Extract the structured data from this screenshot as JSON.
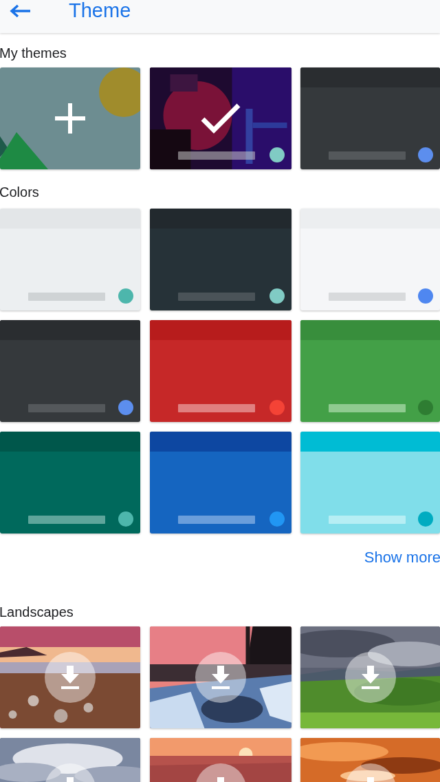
{
  "app_bar": {
    "title": "Theme"
  },
  "sections": [
    {
      "kind": "my_themes",
      "title": "My themes"
    },
    {
      "kind": "colors",
      "title": "Colors"
    },
    {
      "kind": "landscapes",
      "title": "Landscapes"
    }
  ],
  "my_themes": [
    {
      "kind": "add",
      "selected": false
    },
    {
      "kind": "picture",
      "selected": true,
      "dot": {
        "color": "#80cbc4"
      }
    },
    {
      "kind": "color",
      "selected": false,
      "color": "#35393c",
      "header": {
        "color": "#2a2d30"
      },
      "spacebar": {
        "color": "#54585b"
      },
      "dot": {
        "color": "#5c8eee"
      }
    }
  ],
  "colors": [
    {
      "selected": false,
      "color": "#eceff1",
      "header": {
        "color": "#e3e6e8"
      },
      "spacebar": {
        "color": "#cfd3d5"
      },
      "dot": {
        "color": "#4db6ac"
      }
    },
    {
      "selected": false,
      "color": "#263238",
      "header": {
        "color": "#22292e"
      },
      "spacebar": {
        "color": "#4a5358"
      },
      "dot": {
        "color": "#80cbc4"
      }
    },
    {
      "selected": false,
      "color": "#f5f6f8",
      "header": {
        "color": "#eceef0"
      },
      "spacebar": {
        "color": "#d8dadc"
      },
      "dot": {
        "color": "#4f87f0"
      }
    },
    {
      "selected": false,
      "color": "#35393c",
      "header": {
        "color": "#2a2d30"
      },
      "spacebar": {
        "color": "#54585b"
      },
      "dot": {
        "color": "#5c8eee"
      }
    },
    {
      "selected": false,
      "color": "#c62828",
      "header": {
        "color": "#b71c1c"
      },
      "spacebar": {
        "color": "#e08080"
      },
      "dot": {
        "color": "#f44336"
      }
    },
    {
      "selected": false,
      "color": "#43a047",
      "header": {
        "color": "#388e3c"
      },
      "spacebar": {
        "color": "#8fcb90"
      },
      "dot": {
        "color": "#2e7d32"
      }
    },
    {
      "selected": false,
      "color": "#00695c",
      "header": {
        "color": "#00574b"
      },
      "spacebar": {
        "color": "#5ea59b"
      },
      "dot": {
        "color": "#4db6ac"
      }
    },
    {
      "selected": false,
      "color": "#1565c0",
      "header": {
        "color": "#0d47a1"
      },
      "spacebar": {
        "color": "#6a9edb"
      },
      "dot": {
        "color": "#2196f3"
      }
    },
    {
      "selected": false,
      "color": "#80deea",
      "header": {
        "color": "#00bcd4"
      },
      "spacebar": {
        "color": "#b6eef4"
      },
      "dot": {
        "color": "#00acc1"
      }
    }
  ],
  "show_more": "Show more"
}
